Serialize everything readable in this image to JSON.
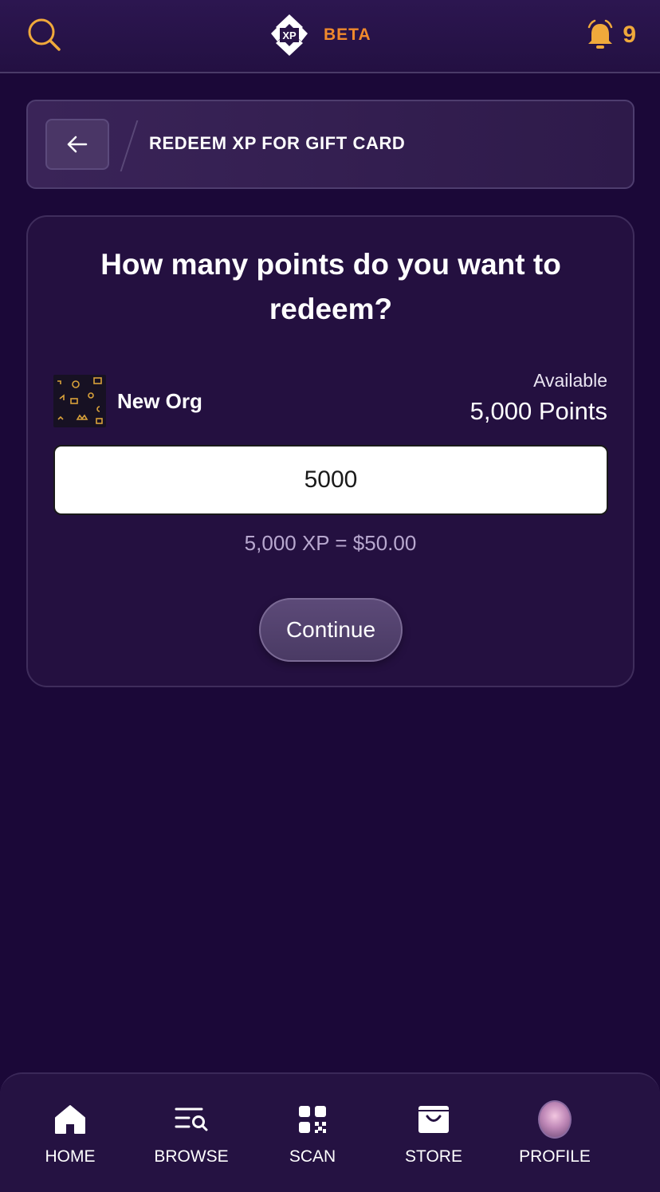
{
  "topbar": {
    "logo_text": "XP",
    "beta_label": "BETA",
    "notification_count": "9",
    "accent_color": "#f0892c",
    "icons": {
      "search": "search-icon",
      "bell": "bell-icon"
    }
  },
  "header": {
    "title": "REDEEM XP FOR GIFT CARD",
    "back_icon": "arrow-left-icon"
  },
  "redeem": {
    "question": "How many points do you want to redeem?",
    "org_name": "New Org",
    "available_label": "Available",
    "available_value": "5,000 Points",
    "input_value": "5000",
    "conversion_text": "5,000 XP = $50.00",
    "continue_label": "Continue"
  },
  "nav": {
    "items": [
      {
        "label": "HOME",
        "icon": "home-icon"
      },
      {
        "label": "BROWSE",
        "icon": "browse-icon"
      },
      {
        "label": "SCAN",
        "icon": "qr-scan-icon"
      },
      {
        "label": "STORE",
        "icon": "store-icon"
      },
      {
        "label": "PROFILE",
        "icon": "avatar"
      }
    ]
  }
}
